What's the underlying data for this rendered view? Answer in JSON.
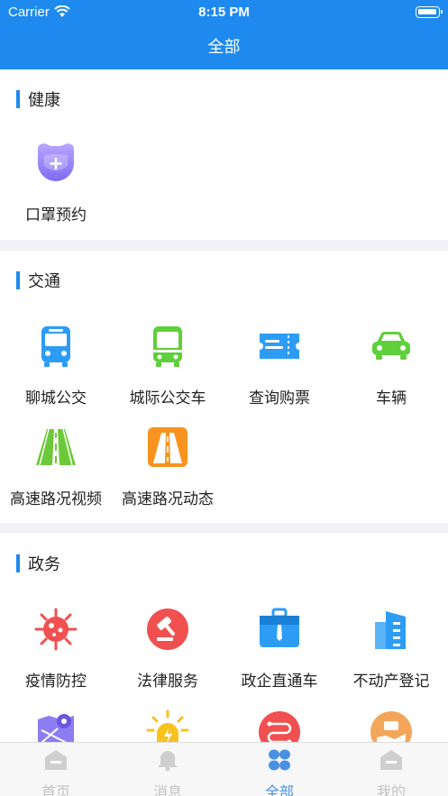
{
  "status": {
    "carrier": "Carrier",
    "time": "8:15 PM"
  },
  "nav": {
    "title": "全部"
  },
  "sections": [
    {
      "title": "健康",
      "items": [
        {
          "label": "口罩预约",
          "icon": "mask-icon"
        }
      ]
    },
    {
      "title": "交通",
      "items": [
        {
          "label": "聊城公交",
          "icon": "bus-icon"
        },
        {
          "label": "城际公交车",
          "icon": "intercity-bus-icon"
        },
        {
          "label": "查询购票",
          "icon": "ticket-icon"
        },
        {
          "label": "车辆",
          "icon": "car-icon"
        },
        {
          "label": "高速路况视频",
          "icon": "highway-video-icon"
        },
        {
          "label": "高速路况动态",
          "icon": "highway-status-icon"
        }
      ]
    },
    {
      "title": "政务",
      "items": [
        {
          "label": "疫情防控",
          "icon": "virus-icon"
        },
        {
          "label": "法律服务",
          "icon": "gavel-icon"
        },
        {
          "label": "政企直通车",
          "icon": "briefcase-icon"
        },
        {
          "label": "不动产登记",
          "icon": "building-icon"
        },
        {
          "label": "",
          "icon": "map-icon"
        },
        {
          "label": "",
          "icon": "alarm-light-icon"
        },
        {
          "label": "",
          "icon": "route-icon"
        },
        {
          "label": "",
          "icon": "hand-service-icon"
        }
      ]
    }
  ],
  "tabs": [
    {
      "label": "首页",
      "icon": "home-icon",
      "active": false
    },
    {
      "label": "消息",
      "icon": "bell-icon",
      "active": false
    },
    {
      "label": "全部",
      "icon": "grid-icon",
      "active": true
    },
    {
      "label": "我的",
      "icon": "profile-icon",
      "active": false
    }
  ],
  "colors": {
    "primary": "#1e8af0",
    "tab_active": "#4a90e2",
    "tab_inactive": "#c2c2c2"
  }
}
